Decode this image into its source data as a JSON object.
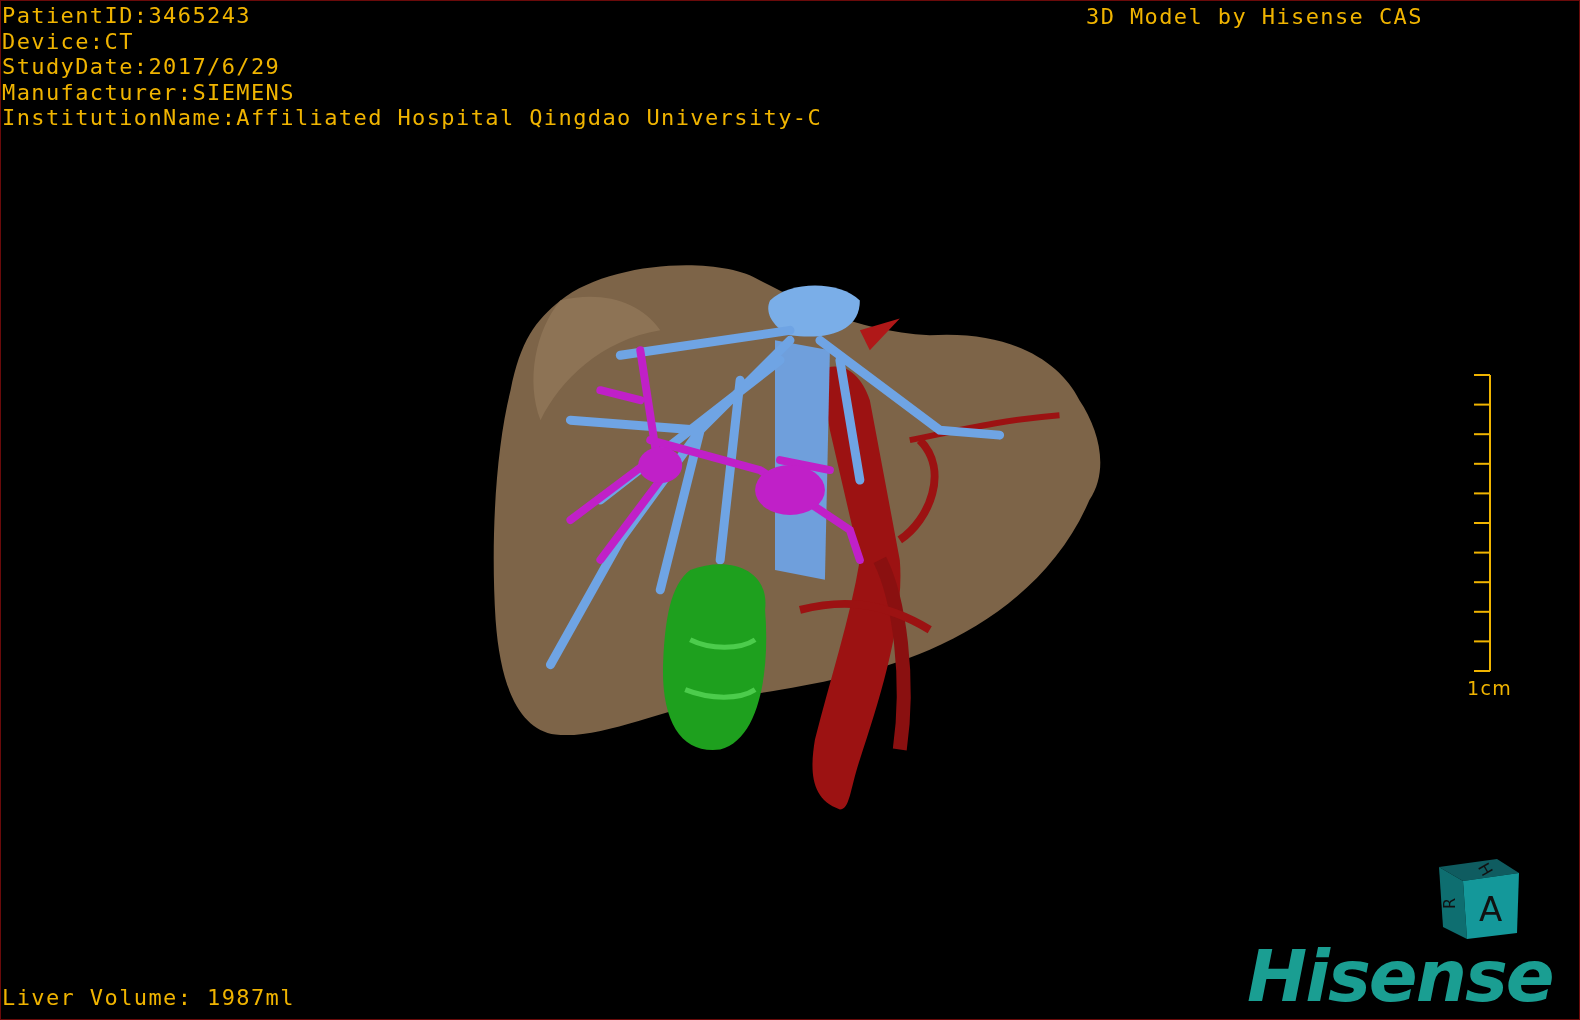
{
  "info_lines": [
    "PatientID:3465243",
    "Device:CT",
    "StudyDate:2017/6/29",
    "Manufacturer:SIEMENS",
    "InstitutionName:Affiliated Hospital Qingdao University-C"
  ],
  "title": "3D Model by Hisense CAS",
  "scale_bar": {
    "label": "1cm"
  },
  "orientation_cube": {
    "top": "H",
    "side": "R",
    "front": "A"
  },
  "liver_volume": "Liver Volume: 1987ml",
  "logo": "Hisense"
}
